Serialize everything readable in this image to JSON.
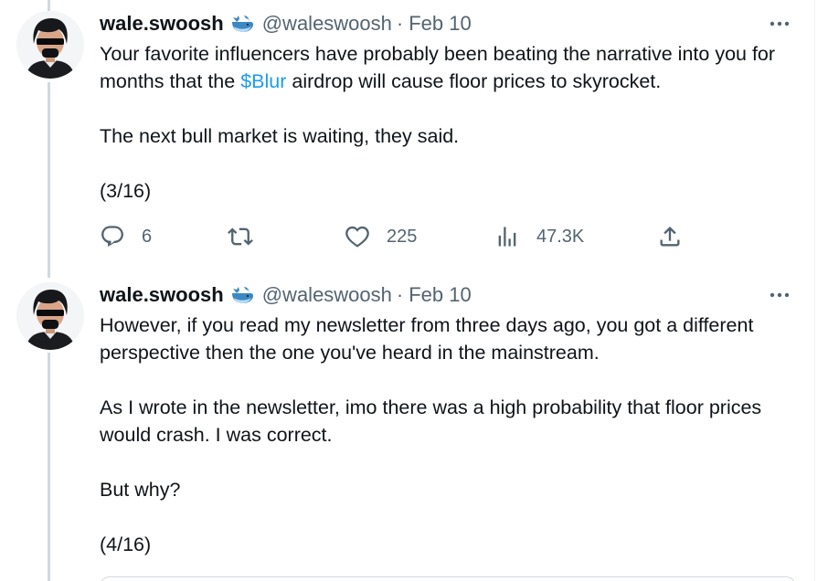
{
  "tweets": [
    {
      "author": {
        "display_name": "wale.swoosh",
        "name_emoji": "whale-emoji",
        "handle": "@waleswoosh",
        "separator": "·",
        "date": "Feb 10"
      },
      "paragraphs": [
        {
          "segments": [
            {
              "text": "Your favorite influencers have probably been beating the narrative into you for months that the ",
              "link": false
            },
            {
              "text": "$Blur",
              "link": true
            },
            {
              "text": " airdrop will cause floor prices to skyrocket.",
              "link": false
            }
          ]
        },
        {
          "segments": [
            {
              "text": "The next bull market is waiting, they said.",
              "link": false
            }
          ]
        },
        {
          "segments": [
            {
              "text": "(3/16)",
              "link": false
            }
          ]
        }
      ],
      "actions": {
        "replies": "6",
        "retweets": "",
        "likes": "225",
        "views": "47.3K"
      }
    },
    {
      "author": {
        "display_name": "wale.swoosh",
        "name_emoji": "whale-emoji",
        "handle": "@waleswoosh",
        "separator": "·",
        "date": "Feb 10"
      },
      "paragraphs": [
        {
          "segments": [
            {
              "text": "However, if you read my newsletter from three days ago, you got a different perspective then the one you've heard in the mainstream.",
              "link": false
            }
          ]
        },
        {
          "segments": [
            {
              "text": "As I wrote in the newsletter, imo there was a high probability that floor prices would crash. I was correct.",
              "link": false
            }
          ]
        },
        {
          "segments": [
            {
              "text": "But why?",
              "link": false
            }
          ]
        },
        {
          "segments": [
            {
              "text": "(4/16)",
              "link": false
            }
          ]
        }
      ]
    }
  ],
  "colors": {
    "text": "#0f1419",
    "secondary": "#536471",
    "link": "#1d9bf0",
    "thread_line": "#cfd9de"
  }
}
